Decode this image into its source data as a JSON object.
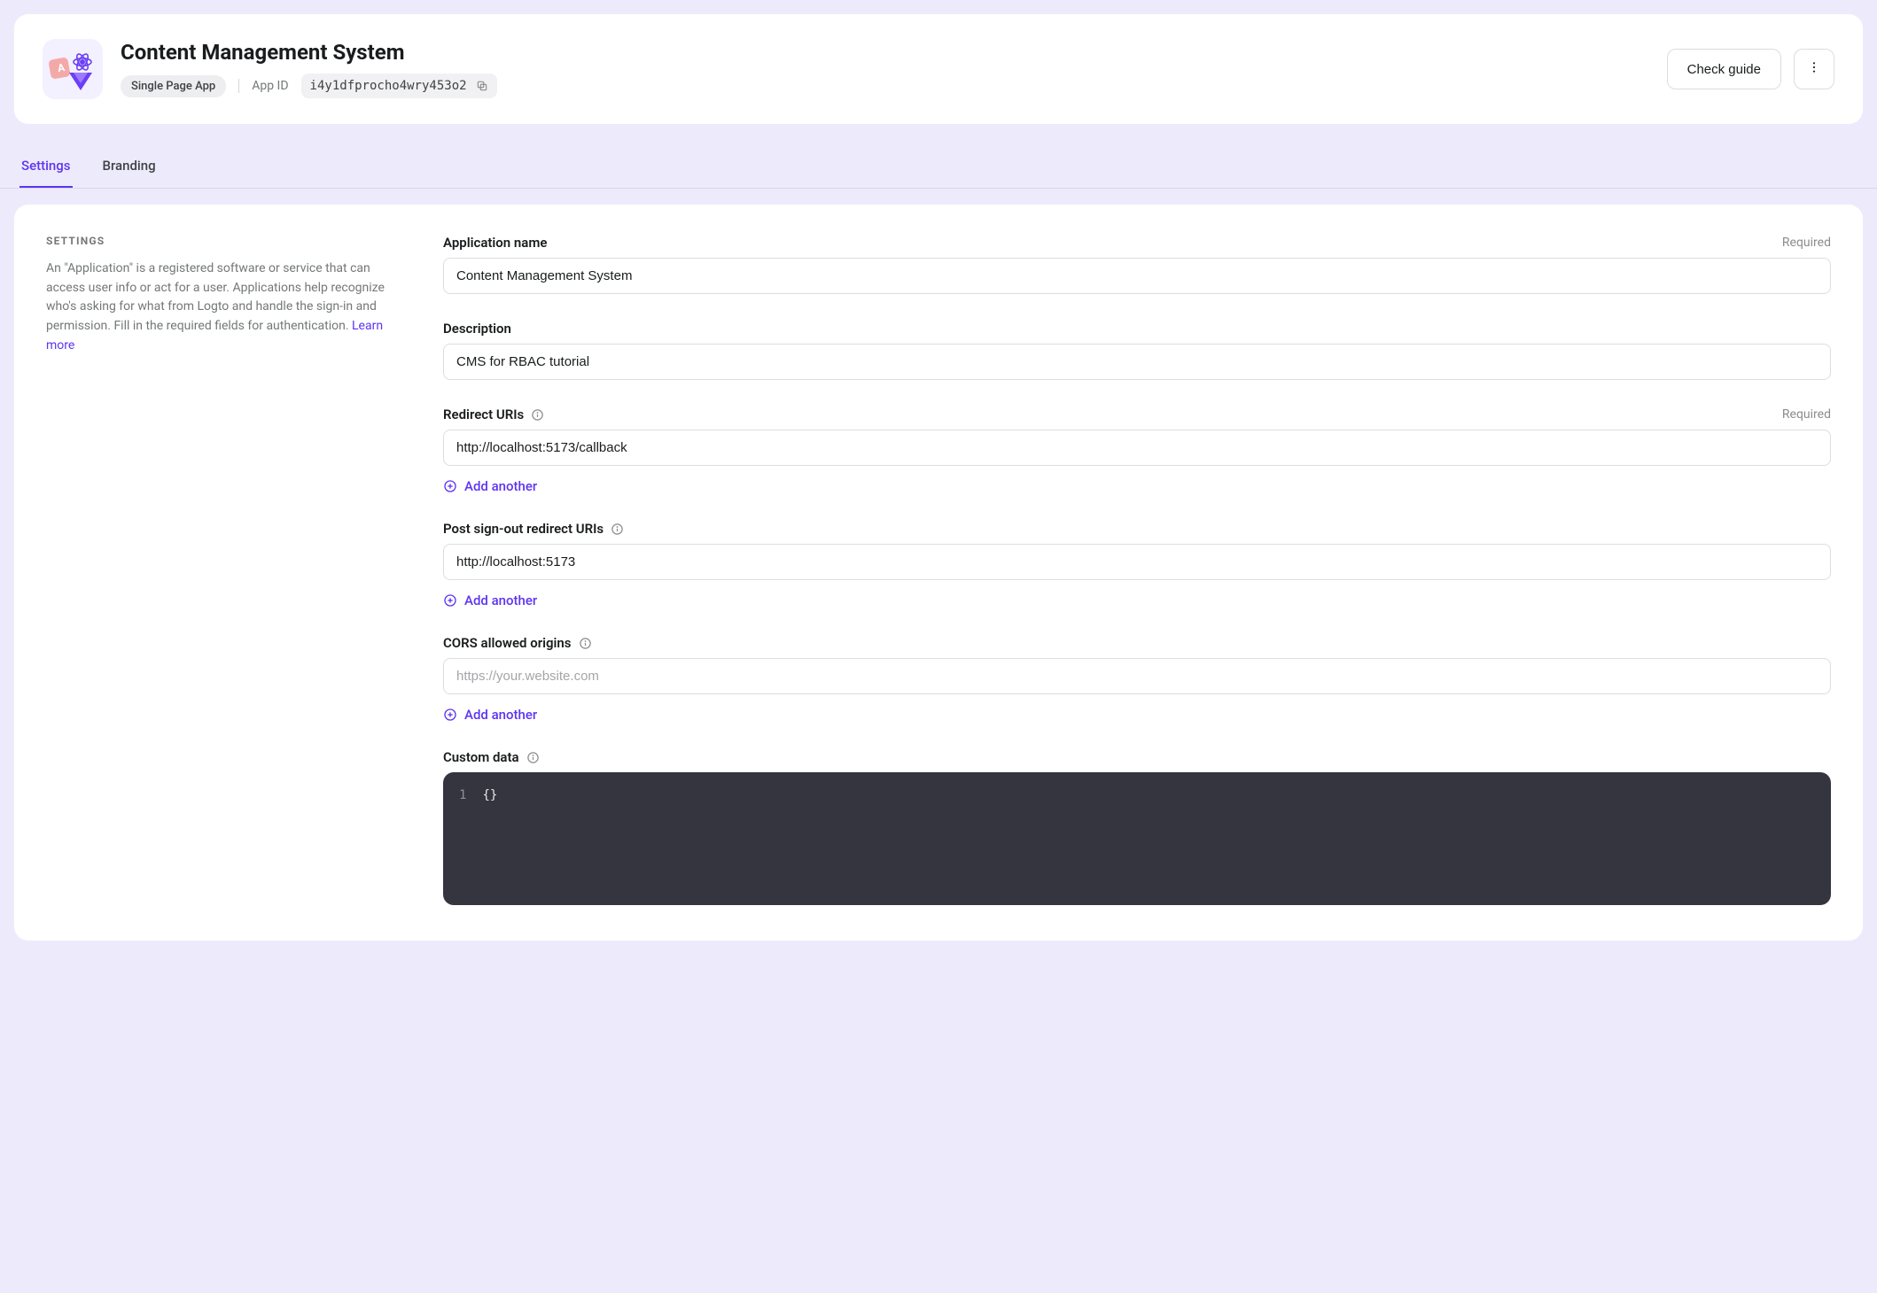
{
  "header": {
    "title": "Content Management System",
    "app_type": "Single Page App",
    "app_id_label": "App ID",
    "app_id": "i4y1dfprocho4wry453o2",
    "check_guide": "Check guide"
  },
  "tabs": {
    "settings": "Settings",
    "branding": "Branding"
  },
  "side": {
    "title": "SETTINGS",
    "desc": "An \"Application\" is a registered software or service that can access user info or act for a user. Applications help recognize who's asking for what from Logto and handle the sign-in and permission. Fill in the required fields for authentication. ",
    "learn": "Learn more"
  },
  "labels": {
    "required": "Required",
    "add_another": "Add another"
  },
  "fields": {
    "app_name": {
      "label": "Application name",
      "value": "Content Management System"
    },
    "description": {
      "label": "Description",
      "value": "CMS for RBAC tutorial"
    },
    "redirect": {
      "label": "Redirect URIs",
      "value": "http://localhost:5173/callback"
    },
    "post_signout": {
      "label": "Post sign-out redirect URIs",
      "value": "http://localhost:5173"
    },
    "cors": {
      "label": "CORS allowed origins",
      "placeholder": "https://your.website.com"
    },
    "custom_data": {
      "label": "Custom data",
      "line_no": "1",
      "content": "{}"
    }
  }
}
